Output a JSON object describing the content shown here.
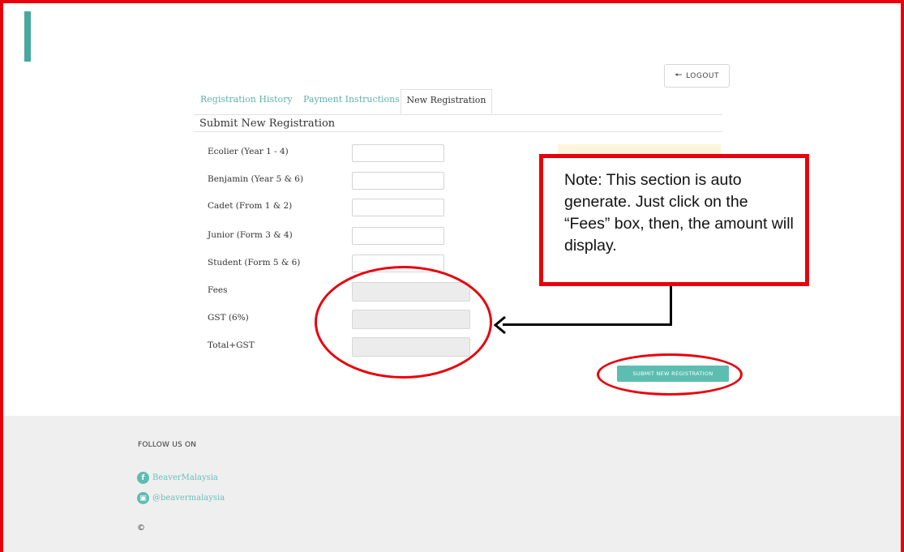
{
  "header": {
    "logout_label": "LOGOUT",
    "logout_icon": "arrow-left-icon"
  },
  "tabs": [
    {
      "label": "Registration History",
      "active": false
    },
    {
      "label": "Payment Instructions",
      "active": false
    },
    {
      "label": "New Registration",
      "active": true
    }
  ],
  "form": {
    "title": "Submit New Registration",
    "rows": [
      {
        "label": "Ecolier (Year 1 - 4)",
        "value": ""
      },
      {
        "label": "Benjamin (Year 5 & 6)",
        "value": ""
      },
      {
        "label": "Cadet (From 1 & 2)",
        "value": ""
      },
      {
        "label": "Junior (Form 3 & 4)",
        "value": ""
      },
      {
        "label": "Student (Form 5 & 6)",
        "value": ""
      },
      {
        "label": "Fees",
        "value": "",
        "readonly": true
      },
      {
        "label": "GST (6%)",
        "value": "",
        "readonly": true
      },
      {
        "label": "Total+GST",
        "value": "",
        "readonly": true
      }
    ],
    "submit_label": "SUBMIT NEW REGISTRATION"
  },
  "annotation": {
    "note_text": "Note: This section is auto generate. Just click on the “Fees” box, then, the amount will display."
  },
  "footer": {
    "follow_label": "FOLLOW US ON",
    "facebook": "BeaverMalaysia",
    "instagram": "@beavermalaysia",
    "copyright": "©"
  },
  "colors": {
    "accent": "#5dbdb1",
    "annotation_red": "#e8000b"
  }
}
